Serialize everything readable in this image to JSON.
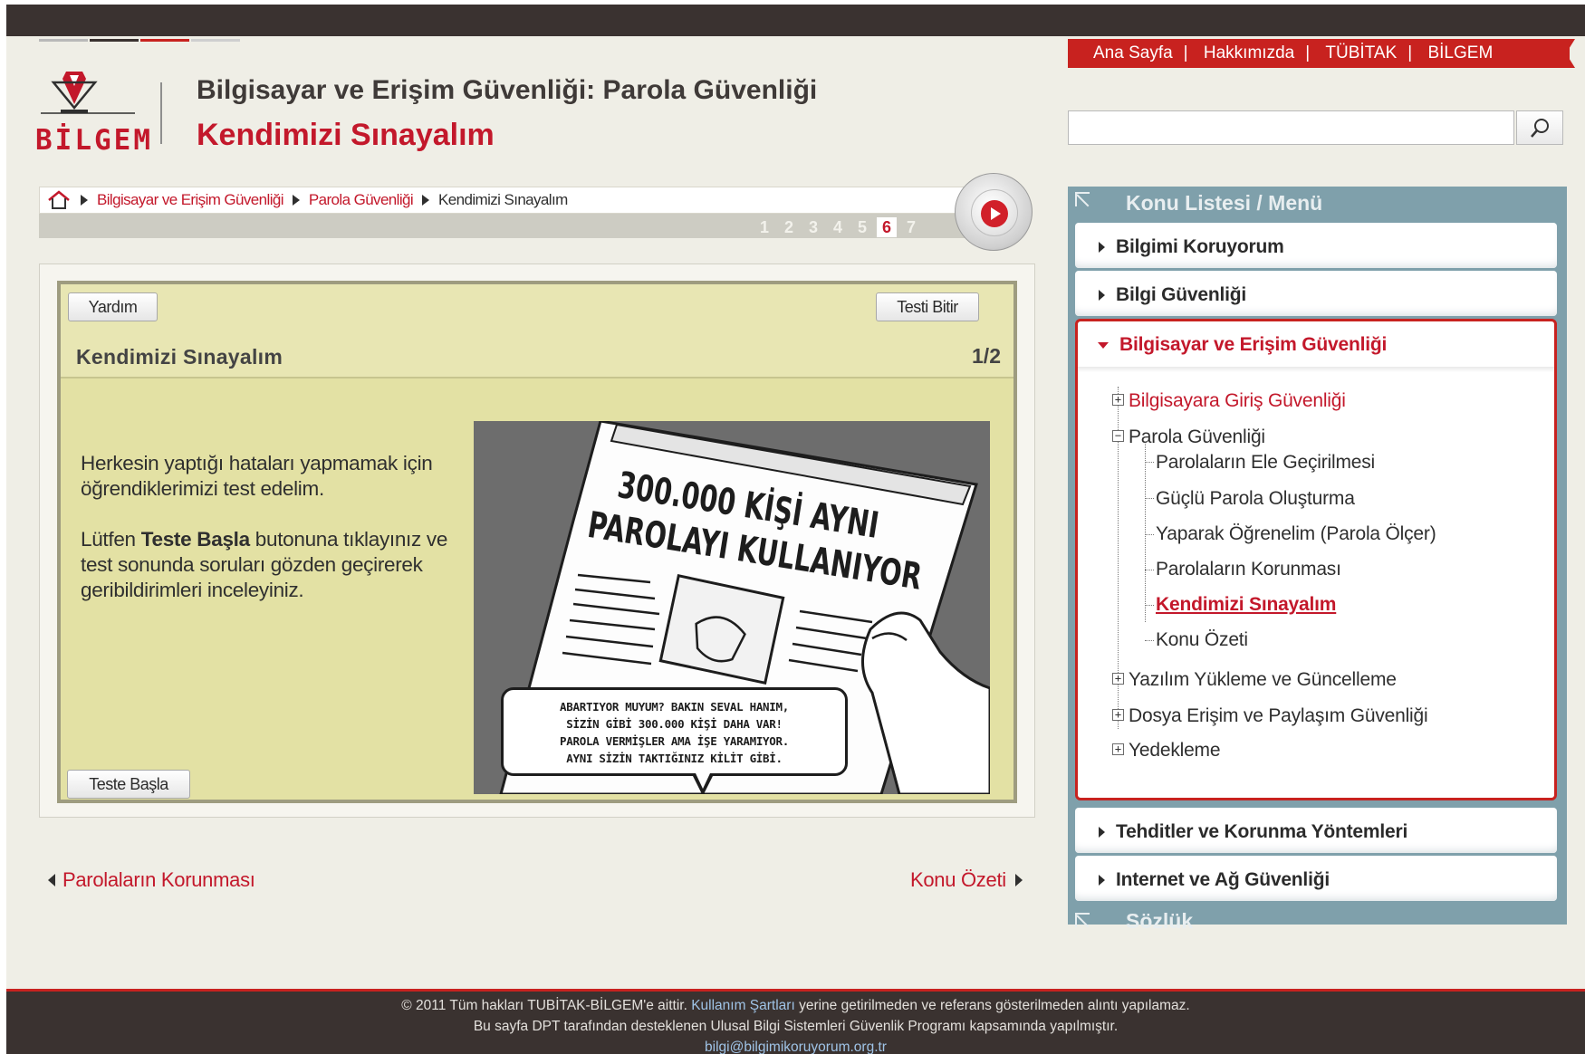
{
  "header": {
    "title": "Bilgisayar ve Erişim Güvenliği: Parola Güvenliği",
    "subtitle": "Kendimizi Sınayalım",
    "logo_text": "BİLGEM"
  },
  "top_links": [
    "Ana Sayfa",
    "Hakkımızda",
    "TÜBİTAK",
    "BİLGEM"
  ],
  "search": {
    "placeholder": "",
    "button_icon": "search-icon"
  },
  "breadcrumb": {
    "home_icon": "home-icon",
    "items": [
      "Bilgisayar ve Erişim Güvenliği",
      "Parola Güvenliği",
      "Kendimizi Sınayalım"
    ]
  },
  "pagination": {
    "pages": [
      "1",
      "2",
      "3",
      "4",
      "5",
      "6",
      "7"
    ],
    "current": "6"
  },
  "quiz": {
    "help_label": "Yardım",
    "finish_label": "Testi Bitir",
    "title": "Kendimizi Sınayalım",
    "counter": "1/2",
    "paragraph1": "Herkesin yaptığı hataları yapmamak için öğrendiklerimizi test edelim.",
    "paragraph2_pre": "Lütfen ",
    "paragraph2_bold": "Teste Başla",
    "paragraph2_post": " butonuna tıklayınız ve test sonunda soruları gözden geçirerek geribildirimleri inceleyiniz.",
    "start_label": "Teste Başla",
    "comic": {
      "headline1": "300.000 KİŞİ AYNI",
      "headline2": "PAROLAYI KULLANIYOR",
      "speech": [
        "ABARTIYOR MUYUM? BAKIN SEVAL HANIM,",
        "SİZİN GİBİ 300.000 KİŞİ DAHA VAR!",
        "PAROLA VERMİŞLER AMA İŞE YARAMIYOR.",
        "AYNI SİZİN TAKTIĞINIZ KİLİT GİBİ."
      ]
    }
  },
  "nav": {
    "prev": "Parolaların Korunması",
    "next": "Konu Özeti"
  },
  "sidebar": {
    "title": "Konu Listesi / Menü",
    "items": [
      "Bilgimi Koruyorum",
      "Bilgi Güvenliği"
    ],
    "open_item": "Bilgisayar ve Erişim Güvenliği",
    "tree": {
      "node1": "Bilgisayara Giriş Güvenliği",
      "node2": "Parola Güvenliği",
      "children": [
        "Parolaların Ele Geçirilmesi",
        "Güçlü Parola Oluşturma",
        "Yaparak Öğrenelim (Parola Ölçer)",
        "Parolaların Korunması",
        "Kendimizi Sınayalım",
        "Konu Özeti"
      ],
      "node3": "Yazılım Yükleme ve Güncelleme",
      "node4": "Dosya Erişim ve Paylaşım Güvenliği",
      "node5": "Yedekleme"
    },
    "items_after": [
      "Tehditler ve Korunma Yöntemleri",
      "Internet ve Ağ Güvenliği"
    ],
    "footer_title": "Sözlük"
  },
  "footer": {
    "line1_pre": "© 2011 Tüm hakları TUBİTAK-BİLGEM'e aittir. ",
    "line1_link": "Kullanım Şartları",
    "line1_post": " yerine getirilmeden ve referans gösterilmeden alıntı yapılamaz.",
    "line2": "Bu sayfa DPT tarafından desteklenen Ulusal Bilgi Sistemleri Güvenlik Programı kapsamında yapılmıştır.",
    "email": "bilgi@bilgimikoruyorum.org.tr"
  },
  "colors": {
    "brand_red": "#c3182b",
    "dark_bar": "#3a3230",
    "sidebar_blue": "#7fa0ab",
    "quiz_bg": "#e3e1a4"
  }
}
